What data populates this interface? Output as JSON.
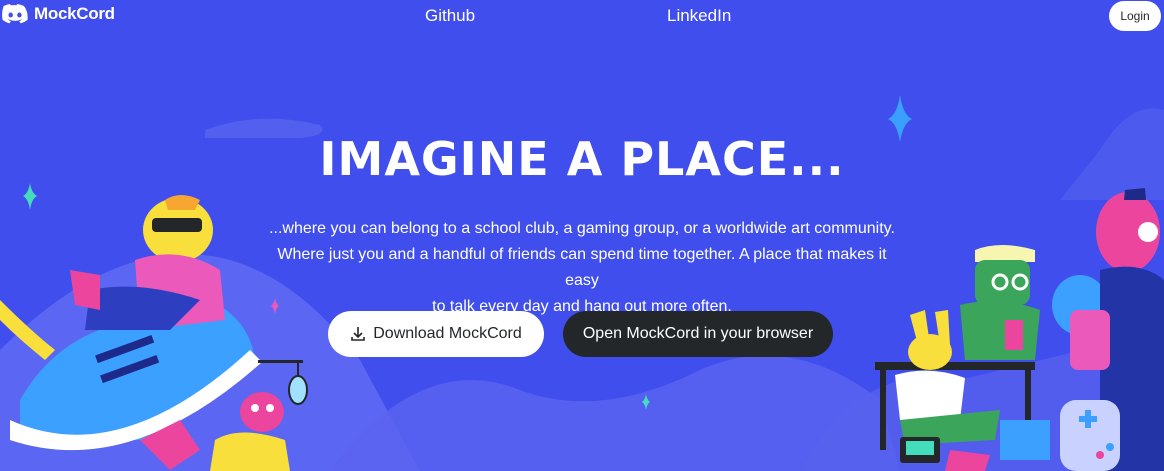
{
  "nav": {
    "brand": "MockCord",
    "links": [
      "Github",
      "LinkedIn"
    ],
    "login_label": "Login"
  },
  "hero": {
    "title": "IMAGINE A PLACE...",
    "description_lines": [
      "...where you can belong to a school club, a gaming group, or a worldwide art community.",
      "Where just you and a handful of friends can spend time together. A place that makes it easy",
      "to talk every day and hang out more often."
    ],
    "download_label": "Download MockCord",
    "browser_label": "Open MockCord in your browser"
  },
  "colors": {
    "background": "#404eed",
    "dark_button": "#23272a",
    "light_button": "#ffffff",
    "sparkle": "#44ddbb"
  },
  "icons": [
    "discord-logo-icon",
    "download-icon"
  ]
}
